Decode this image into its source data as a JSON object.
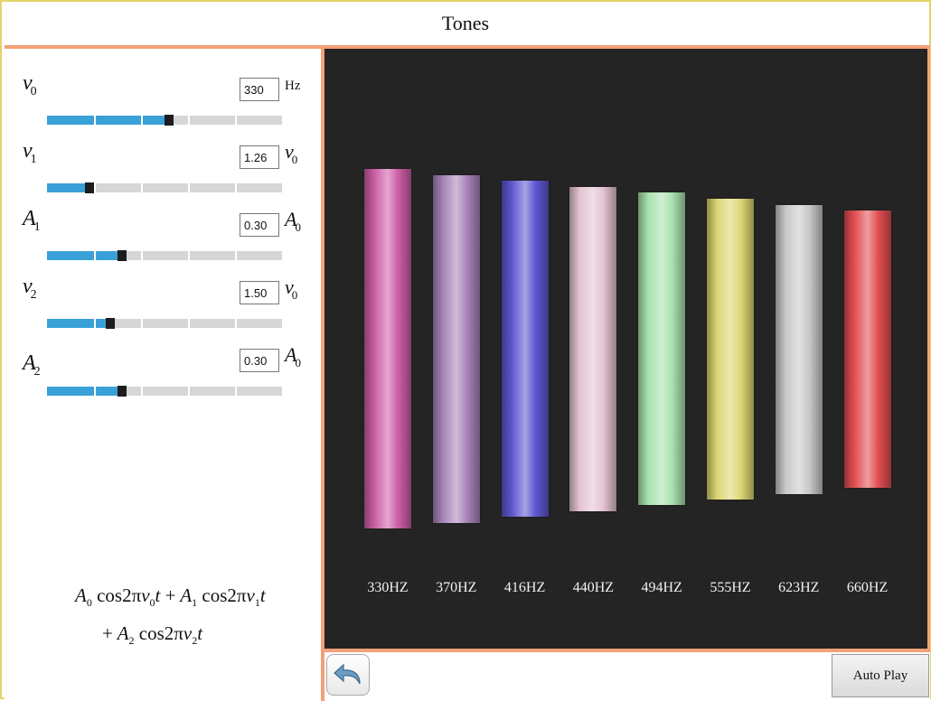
{
  "app": {
    "title": "Tones"
  },
  "params": [
    {
      "symbol": "ν",
      "sub": "0",
      "value": "330",
      "unit_symbol": "Hz",
      "unit_sub": "",
      "level": 0.5
    },
    {
      "symbol": "ν",
      "sub": "1",
      "value": "1.26",
      "unit_symbol": "ν",
      "unit_sub": "0",
      "level": 0.16
    },
    {
      "symbol": "A",
      "sub": "1",
      "value": "0.30",
      "unit_symbol": "A",
      "unit_sub": "0",
      "level": 0.3
    },
    {
      "symbol": "ν",
      "sub": "2",
      "value": "1.50",
      "unit_symbol": "ν",
      "unit_sub": "0",
      "level": 0.25
    },
    {
      "symbol": "A",
      "sub": "2",
      "value": "0.30",
      "unit_symbol": "A",
      "unit_sub": "0",
      "level": 0.3
    }
  ],
  "formula": {
    "A": "A",
    "cos": "cos",
    "two_pi": "2π",
    "nu": "ν",
    "t": "t",
    "plus": "+",
    "s0": "0",
    "s1": "1",
    "s2": "2"
  },
  "tones": [
    {
      "label": "330HZ",
      "color": "#cc5ea6"
    },
    {
      "label": "370HZ",
      "color": "#a784b9"
    },
    {
      "label": "416HZ",
      "color": "#5e57d0"
    },
    {
      "label": "440HZ",
      "color": "#e4c3d2"
    },
    {
      "label": "494HZ",
      "color": "#a9e2af"
    },
    {
      "label": "555HZ",
      "color": "#dbd773"
    },
    {
      "label": "623HZ",
      "color": "#c8c8c8"
    },
    {
      "label": "660HZ",
      "color": "#e24e52"
    }
  ],
  "toolbar": {
    "undo_icon": "undo-icon",
    "auto_play_label": "Auto Play"
  }
}
